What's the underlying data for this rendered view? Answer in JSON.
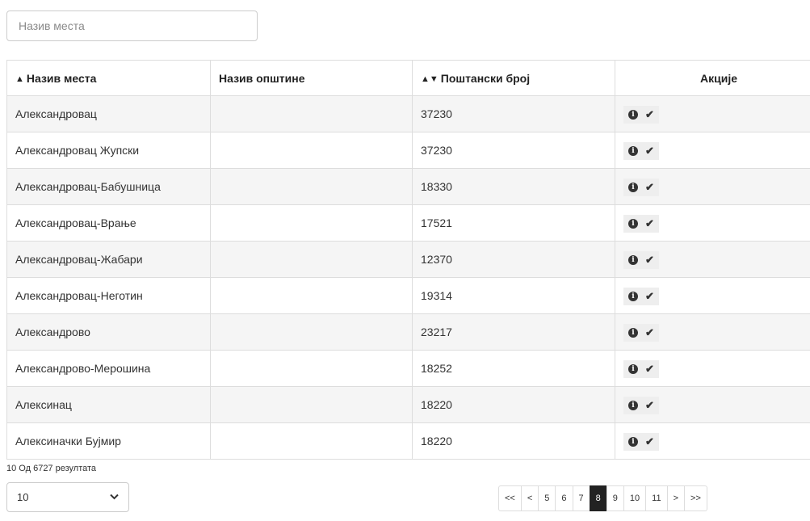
{
  "search": {
    "placeholder": "Назив места",
    "value": ""
  },
  "table": {
    "headers": {
      "place": "Назив места",
      "municipality": "Назив општине",
      "postal": "Поштански број",
      "actions": "Акције"
    },
    "rows": [
      {
        "place": "Александровац",
        "municipality": "",
        "postal": "37230"
      },
      {
        "place": "Александровац Жупски",
        "municipality": "",
        "postal": "37230"
      },
      {
        "place": "Александровац-Бабушница",
        "municipality": "",
        "postal": "18330"
      },
      {
        "place": "Александровац-Врање",
        "municipality": "",
        "postal": "17521"
      },
      {
        "place": "Александровац-Жабари",
        "municipality": "",
        "postal": "12370"
      },
      {
        "place": "Александровац-Неготин",
        "municipality": "",
        "postal": "19314"
      },
      {
        "place": "Александрово",
        "municipality": "",
        "postal": "23217"
      },
      {
        "place": "Александрово-Мерошина",
        "municipality": "",
        "postal": "18252"
      },
      {
        "place": "Алексинац",
        "municipality": "",
        "postal": "18220"
      },
      {
        "place": "Алексиначки Бујмир",
        "municipality": "",
        "postal": "18220"
      }
    ]
  },
  "icons": {
    "sort_asc": "▲",
    "sort_both": "▲▼",
    "info": "i",
    "check": "✔",
    "chevron": "chevron-down-icon"
  },
  "footer": {
    "count_text": "10 Од 6727 резултата",
    "page_size": "10",
    "pages": [
      "<<",
      "<",
      "5",
      "6",
      "7",
      "8",
      "9",
      "10",
      "11",
      ">",
      ">>"
    ],
    "active_page": "8"
  }
}
